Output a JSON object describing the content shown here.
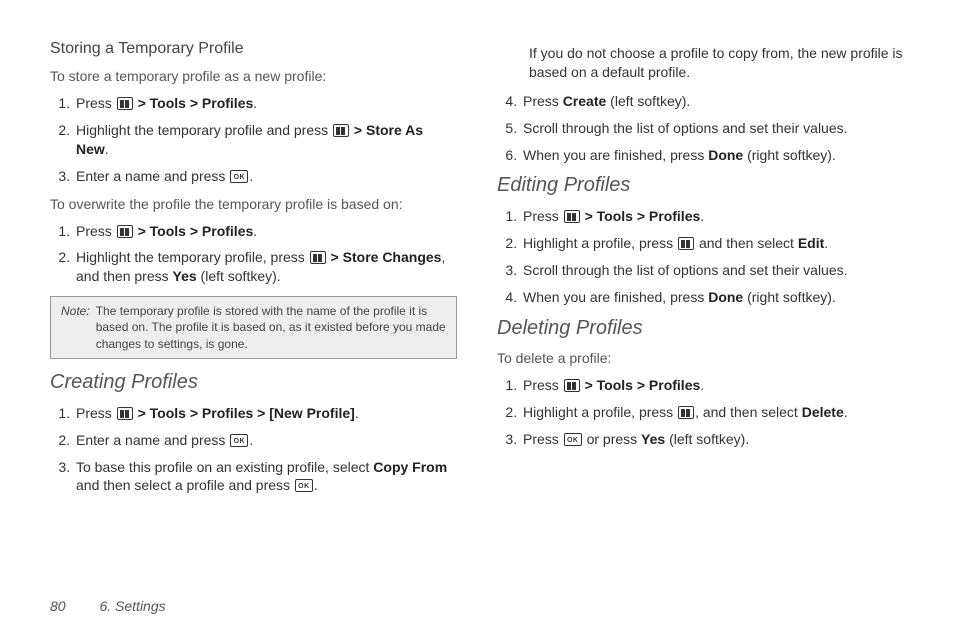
{
  "footer": {
    "page_number": "80",
    "section": "6. Settings"
  },
  "left": {
    "h_storing": "Storing a Temporary Profile",
    "intro1": "To store a temporary profile as a new profile:",
    "list1": {
      "i1a": "Press ",
      "i1b": " > ",
      "i1c": "Tools",
      "i1d": " > ",
      "i1e": "Profiles",
      "i1f": ".",
      "i2a": "Highlight the temporary profile and press ",
      "i2b": " > ",
      "i2c": "Store As New",
      "i2d": ".",
      "i3a": "Enter a name and press ",
      "i3b": "."
    },
    "intro2": "To overwrite the profile the temporary profile is based on:",
    "list2": {
      "i1a": "Press ",
      "i1b": " > ",
      "i1c": "Tools",
      "i1d": " > ",
      "i1e": "Profiles",
      "i1f": ".",
      "i2a": "Highlight the temporary profile, press ",
      "i2b": " > ",
      "i2c": "Store Changes",
      "i2d": ", and then press ",
      "i2e": "Yes",
      "i2f": " (left softkey)."
    },
    "note_label": "Note:",
    "note_text": "The temporary profile is stored with the name of the profile it is based on. The profile it is based on, as it existed before you made changes to settings, is gone.",
    "h_creating": "Creating Profiles",
    "list3": {
      "i1a": "Press ",
      "i1b": " > ",
      "i1c": "Tools",
      "i1d": " > ",
      "i1e": "Profiles",
      "i1f": " > ",
      "i1g": "[New Profile]",
      "i1h": ".",
      "i2a": "Enter a name and press ",
      "i2b": ".",
      "i3a": "To base this profile on an existing profile, select ",
      "i3b": "Copy From",
      "i3c": " and then select a profile and press ",
      "i3d": "."
    }
  },
  "right": {
    "cont": {
      "pa": "If you do not choose a profile to copy from, the new profile is based on a default profile.",
      "i4a": "Press ",
      "i4b": "Create",
      "i4c": " (left softkey).",
      "i5a": "Scroll through the list of options and set their values.",
      "i6a": "When you are finished, press ",
      "i6b": "Done",
      "i6c": " (right softkey)."
    },
    "h_editing": "Editing Profiles",
    "list_e": {
      "i1a": "Press ",
      "i1b": " > ",
      "i1c": "Tools",
      "i1d": " > ",
      "i1e": "Profiles",
      "i1f": ".",
      "i2a": "Highlight a profile, press ",
      "i2b": " and then select ",
      "i2c": "Edit",
      "i2d": ".",
      "i3a": "Scroll through the list of options and set their values.",
      "i4a": "When you are finished, press ",
      "i4b": "Done",
      "i4c": " (right softkey)."
    },
    "h_deleting": "Deleting Profiles",
    "intro_d": "To delete a profile:",
    "list_d": {
      "i1a": "Press ",
      "i1b": " > ",
      "i1c": "Tools",
      "i1d": " > ",
      "i1e": "Profiles",
      "i1f": ".",
      "i2a": "Highlight a profile, press ",
      "i2b": ", and then select ",
      "i2c": "Delete",
      "i2d": ".",
      "i3a": "Press ",
      "i3b": " or press ",
      "i3c": "Yes",
      "i3d": " (left softkey)."
    }
  }
}
